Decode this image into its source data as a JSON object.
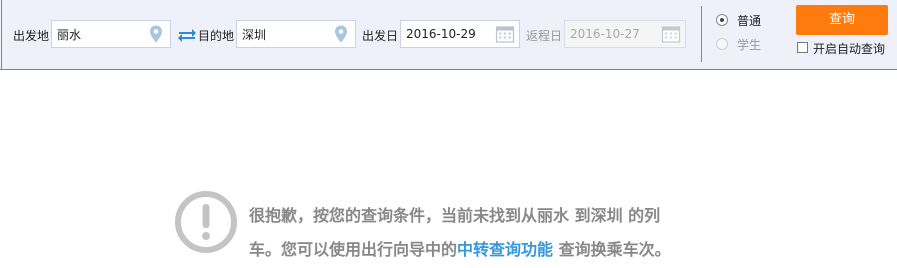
{
  "search": {
    "from_label": "出发地",
    "from_value": "丽水",
    "to_label": "目的地",
    "to_value": "深圳",
    "depart_label": "出发日",
    "depart_date": "2016-10-29",
    "return_label": "返程日",
    "return_date": "2016-10-27"
  },
  "ticket_type": {
    "options": [
      "普通",
      "学生"
    ],
    "selected": "普通"
  },
  "actions": {
    "query_label": "查询",
    "auto_query_label": "开启自动查询",
    "auto_query_checked": false
  },
  "result": {
    "message_part1": "很抱歉，按您的查询条件，当前未找到从丽水 到深圳 的列车。您可以使用出行向导中的",
    "link_text": "中转查询功能",
    "message_part2": " 查询换乘车次。"
  },
  "icons": {
    "location": "location-pin-icon",
    "swap": "swap-arrows-icon",
    "calendar": "calendar-icon",
    "notice": "exclamation-circle-icon"
  },
  "colors": {
    "accent_blue": "#3b99d4",
    "query_orange": "#ff7b0d",
    "link_blue": "#3498db"
  }
}
